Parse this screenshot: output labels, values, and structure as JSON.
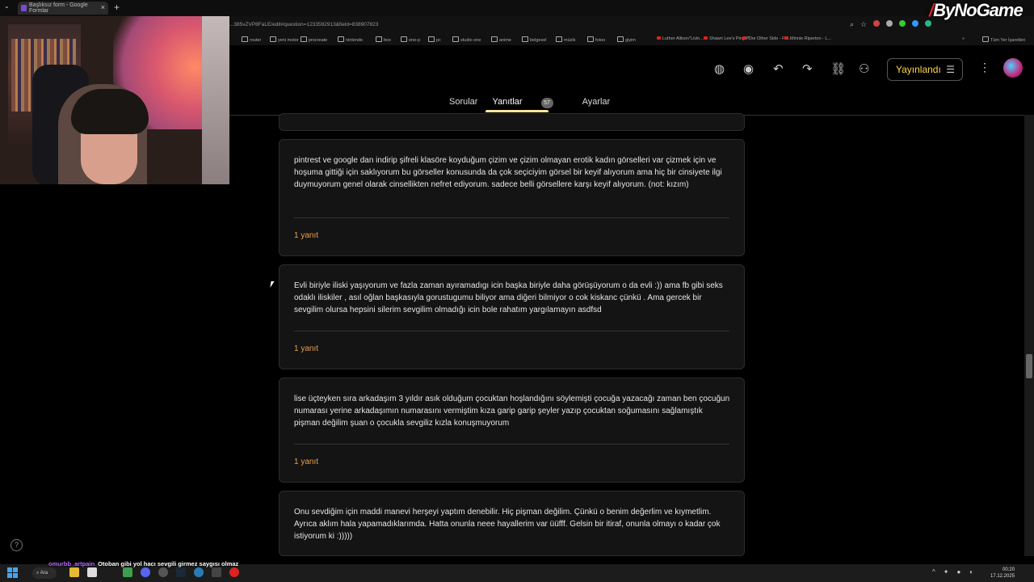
{
  "browser": {
    "tab_title": "Başlıksız form - Google Formlar",
    "tab_close": "×",
    "new_tab": "+",
    "tab_menu": "⌄",
    "url": "...385vZVP8FaLE/edit#question=1233592913&field=838907823"
  },
  "watermark": "ByNoGame",
  "bookmarks": [
    {
      "label": "router",
      "type": "folder"
    },
    {
      "label": "yeni motor",
      "type": "folder"
    },
    {
      "label": "procreate",
      "type": "folder"
    },
    {
      "label": "nintendo",
      "type": "folder"
    },
    {
      "label": "box",
      "type": "folder"
    },
    {
      "label": "one-p",
      "type": "folder"
    },
    {
      "label": "pc",
      "type": "folder"
    },
    {
      "label": "studio one",
      "type": "folder"
    },
    {
      "label": "anime",
      "type": "folder"
    },
    {
      "label": "belgesel",
      "type": "folder"
    },
    {
      "label": "müzik",
      "type": "folder"
    },
    {
      "label": "fotoo",
      "type": "folder"
    },
    {
      "label": "giyim",
      "type": "folder"
    },
    {
      "label": "Luther Allison\"Livin...",
      "type": "yt"
    },
    {
      "label": "Shawn Lee's Ping P...",
      "type": "yt"
    },
    {
      "label": "The Other Side - Fre...",
      "type": "yt"
    },
    {
      "label": "Minnie Riperton - L...",
      "type": "yt"
    }
  ],
  "bookmarks_more": "»",
  "bookmarks_all": "Tüm Yer İşaretleri",
  "toolbar": {
    "publish_label": "Yayınlandı"
  },
  "form_tabs": {
    "questions": "Sorular",
    "responses": "Yanıtlar",
    "responses_count": "57",
    "settings": "Ayarlar"
  },
  "responses": [
    {
      "text": "pintrest ve google dan indirip şifreli klasöre koyduğum çizim ve çizim olmayan erotik kadın görselleri var çizmek için ve hoşuma gittiği için saklıyorum bu görseller konusunda da çok seçiciyim görsel bir keyif alıyorum ama hiç bir cinsiyete ilgi duymuyorum genel olarak cinsellikten nefret ediyorum. sadece belli görsellere karşı keyif alıyorum. (not: kızım)",
      "reply": "1 yanıt"
    },
    {
      "text": "Evli biriyle iliski yaşıyorum ve fazla zaman ayıramadıgı icin başka biriyle daha görüşüyorum o da evli :)) ama fb gibi seks odaklı iliskiler , asıl oğlan başkasıyla gorustugumu biliyor ama diğeri bilmiyor o cok kiskanc çünkü . Ama gercek bir sevgilim olursa hepsini silerim sevgilim olmadığı icin bole rahatım yargılamayın asdfsd",
      "reply": "1 yanıt"
    },
    {
      "text": "lise üçteyken sıra arkadaşım 3 yıldır asık olduğum çocuktan hoşlandığını söylemişti çocuğa yazacağı zaman ben çocuğun numarası yerine arkadaşımın numarasını vermiştim kıza garip garip şeyler yazıp çocuktan soğumasını sağlamıştık pişman değilim şuan o çocukla sevgiliz kızla konuşmuyorum",
      "reply": "1 yanıt"
    },
    {
      "text": "Onu sevdiğim için maddi manevi herşeyi yaptım denebilir. Hiç pişman değilim. Çünkü o benim değerlim ve kıymetlim. Ayrıca aklım hala yapamadıklarımda. Hatta onunla neee hayallerim var üüfff. Gelsin bir itiraf, onunla olmayı o kadar çok istiyorum ki :)))))"
    }
  ],
  "taskbar": {
    "search_label": "Ara",
    "time": "00:20",
    "date": "17.12.2025"
  },
  "chat": {
    "user": "omurbb_artpain",
    "message": "Otoban gibi yol hacı sevgili girmez saygısı olmaz"
  },
  "help_label": "?"
}
